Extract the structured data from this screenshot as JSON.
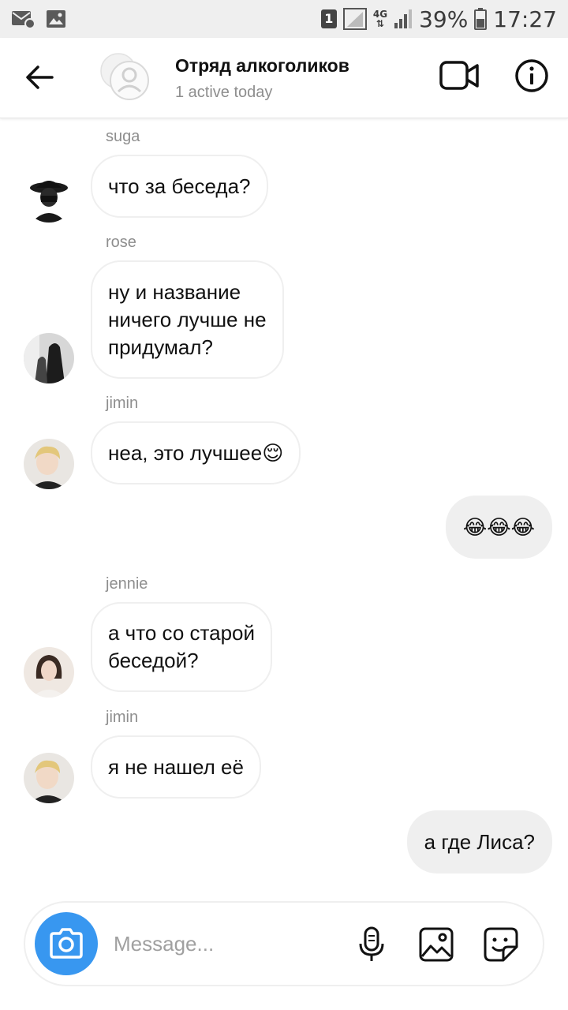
{
  "status_bar": {
    "sim": "1",
    "network": "4G",
    "battery": "39%",
    "time": "17:27"
  },
  "header": {
    "title": "Отряд алкоголиков",
    "subtitle": "1 active today"
  },
  "messages": [
    {
      "sender": "suga",
      "text": "что за беседа?"
    },
    {
      "sender": "rose",
      "lines": [
        "ну и название",
        "ничего лучше не",
        "придумал?"
      ]
    },
    {
      "sender": "jimin",
      "text": "неа, это лучшее😌"
    },
    {
      "sender": "me",
      "text": "😂😂😂"
    },
    {
      "sender": "jennie",
      "lines": [
        "а что со старой",
        "беседой?"
      ]
    },
    {
      "sender": "jimin",
      "text": "я не нашел её"
    },
    {
      "sender": "me",
      "text": "а где Лиса?"
    }
  ],
  "composer": {
    "placeholder": "Message..."
  },
  "colors": {
    "accent": "#3897f0",
    "outgoing_bubble": "#efefef",
    "muted_text": "#8e8e8e"
  }
}
